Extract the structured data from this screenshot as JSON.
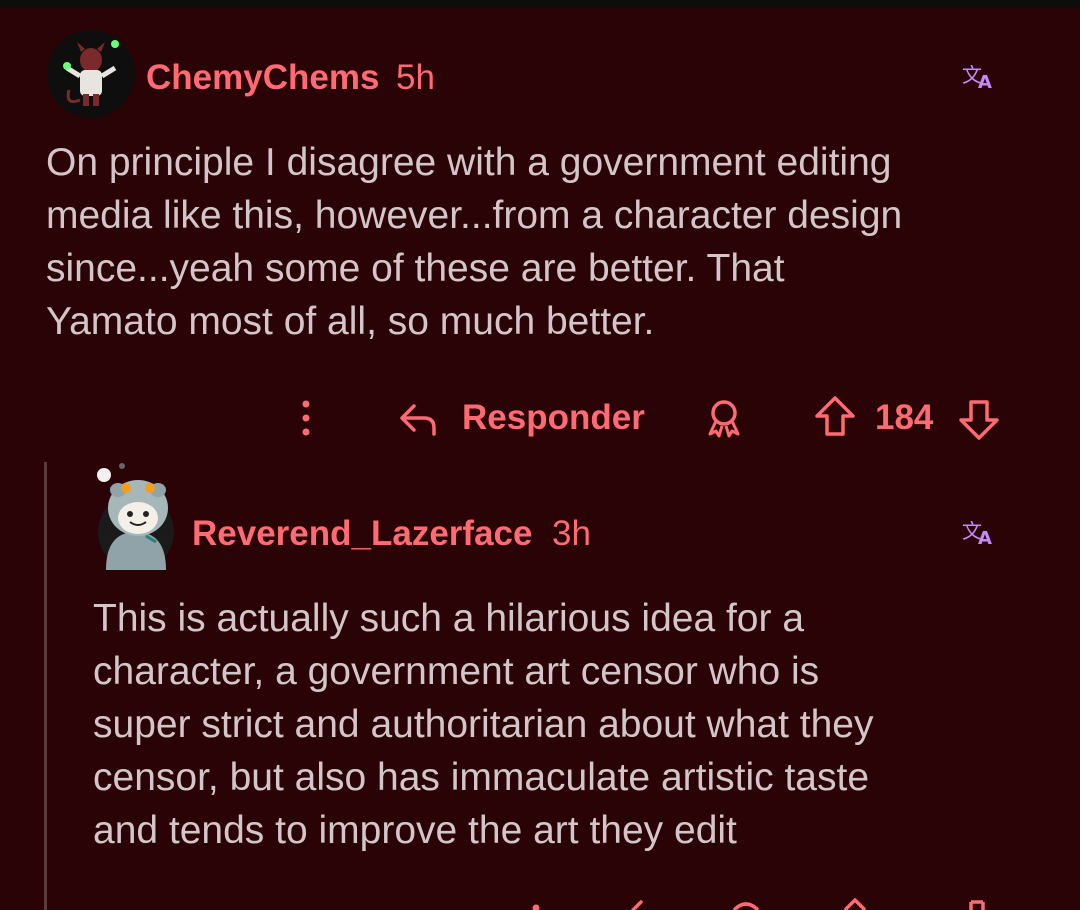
{
  "comments": [
    {
      "username": "ChemyChems",
      "time": "5h",
      "body_lines": [
        "On principle I disagree with a government editing",
        "media like this, however...from a character design",
        "since...yeah some of these are better. That",
        "Yamato most of all, so much better."
      ],
      "actions": {
        "reply_label": "Responder",
        "vote_count": "184"
      }
    },
    {
      "username": "Reverend_Lazerface",
      "time": "3h",
      "body_lines": [
        "This is actually such a hilarious idea for a",
        "character, a government art censor who is",
        "super strict and authoritarian about what they",
        "censor, but also has immaculate artistic taste",
        "and tends to improve the art they edit"
      ]
    }
  ],
  "colors": {
    "background": "#2a0306",
    "username": "#ff6a73",
    "body_text": "#d4c6c8",
    "translate_icon": "#c58bff",
    "thread_line": "#5a3b3e"
  },
  "icons": [
    "translate-icon",
    "more-options-icon",
    "reply-icon",
    "award-icon",
    "upvote-icon",
    "downvote-icon"
  ]
}
